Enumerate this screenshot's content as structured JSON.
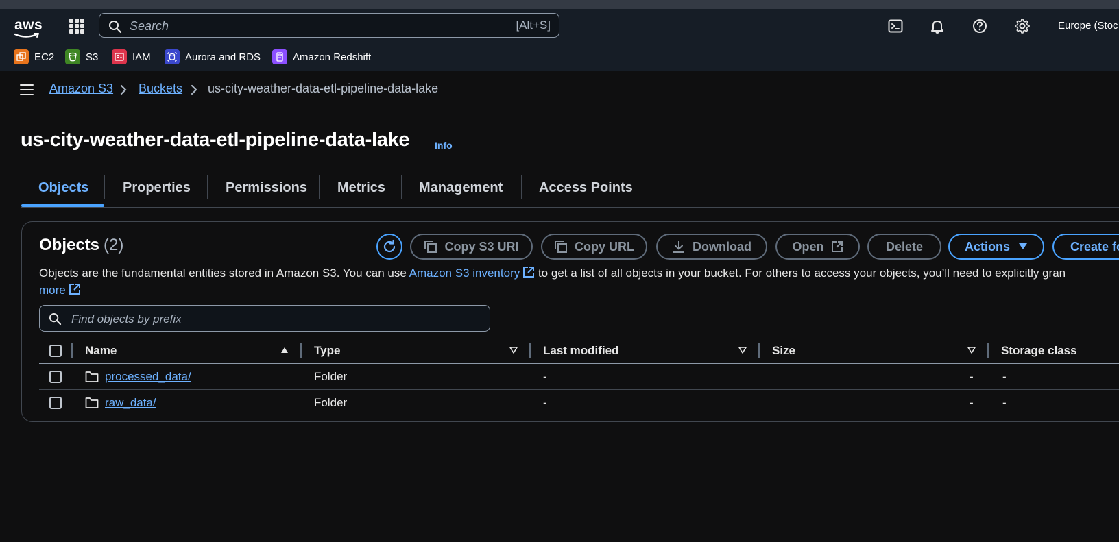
{
  "topnav": {
    "logo_text": "aws",
    "search_placeholder": "Search",
    "search_shortcut": "[Alt+S]",
    "region": "Europe (Stoc",
    "icons": [
      "grid-icon",
      "search-icon",
      "cloudshell-icon",
      "bell-icon",
      "help-icon",
      "gear-icon"
    ]
  },
  "favorites": [
    {
      "label": "EC2",
      "color": "#e8741c"
    },
    {
      "label": "S3",
      "color": "#3f8624"
    },
    {
      "label": "IAM",
      "color": "#dd344c"
    },
    {
      "label": "Aurora and RDS",
      "color": "#3b48cc"
    },
    {
      "label": "Amazon Redshift",
      "color": "#8c4fff"
    }
  ],
  "breadcrumb": {
    "items": [
      "Amazon S3",
      "Buckets",
      "us-city-weather-data-etl-pipeline-data-lake"
    ]
  },
  "page": {
    "title": "us-city-weather-data-etl-pipeline-data-lake",
    "info_label": "Info"
  },
  "tabs": [
    {
      "label": "Objects",
      "active": true
    },
    {
      "label": "Properties",
      "active": false
    },
    {
      "label": "Permissions",
      "active": false
    },
    {
      "label": "Metrics",
      "active": false
    },
    {
      "label": "Management",
      "active": false
    },
    {
      "label": "Access Points",
      "active": false
    }
  ],
  "objects_panel": {
    "title": "Objects",
    "count": "(2)",
    "buttons": {
      "copy_s3_uri": "Copy S3 URI",
      "copy_url": "Copy URL",
      "download": "Download",
      "open": "Open",
      "delete": "Delete",
      "actions": "Actions",
      "create_folder": "Create fo"
    },
    "description": {
      "part1": "Objects are the fundamental entities stored in Amazon S3. You can use ",
      "link": "Amazon S3 inventory",
      "part2": " to get a list of all objects in your bucket. For others to access your objects, you’ll need to explicitly gran",
      "more": "more"
    },
    "filter_placeholder": "Find objects by prefix",
    "columns": [
      "Name",
      "Type",
      "Last modified",
      "Size",
      "Storage class"
    ],
    "rows": [
      {
        "name": "processed_data/",
        "type": "Folder",
        "last_modified": "-",
        "size": "-",
        "storage_class": "-"
      },
      {
        "name": "raw_data/",
        "type": "Folder",
        "last_modified": "-",
        "size": "-",
        "storage_class": "-"
      }
    ]
  },
  "colors": {
    "accent": "#6db1ff",
    "background": "#0f0f10",
    "nav": "#161d26"
  }
}
